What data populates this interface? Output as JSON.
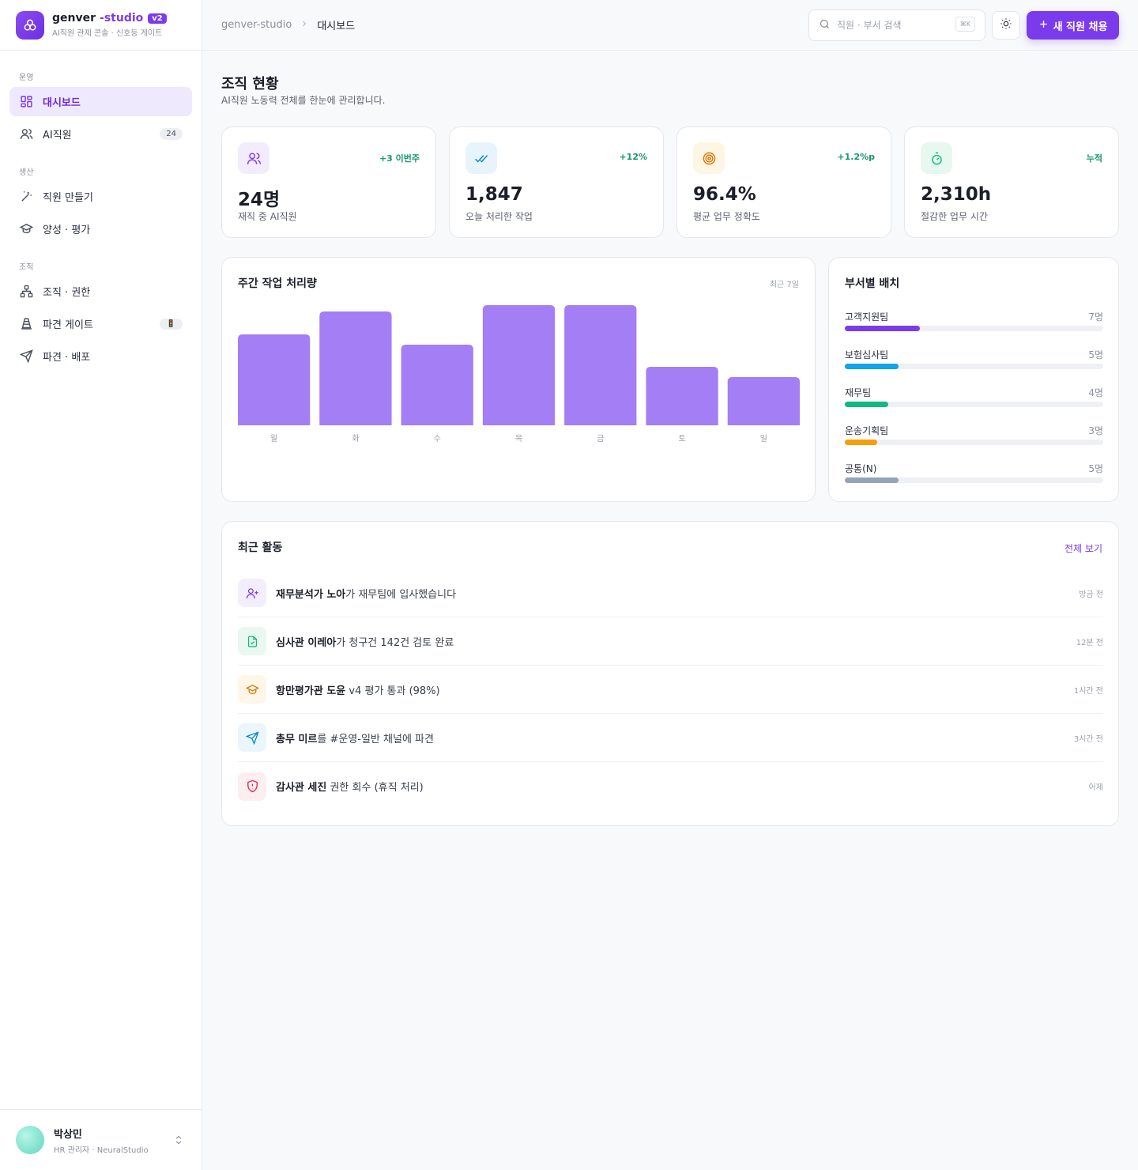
{
  "brand": {
    "name": "genver",
    "suffix": "-studio",
    "badge": "v2",
    "subtitle": "AI직원 관제 콘솔 · 신호등 게이트"
  },
  "nav": {
    "sections": [
      "운영",
      "생산",
      "조직"
    ],
    "items": [
      {
        "label": "대시보드",
        "icon": "dashboard-icon"
      },
      {
        "label": "AI직원",
        "icon": "users-icon",
        "count": "24"
      },
      {
        "label": "직원 만들기",
        "icon": "magic-wand-icon"
      },
      {
        "label": "양성 · 평가",
        "icon": "graduation-cap-icon"
      },
      {
        "label": "조직 · 권한",
        "icon": "org-chart-icon"
      },
      {
        "label": "파견 게이트",
        "icon": "cone-icon",
        "badge": "🚦"
      },
      {
        "label": "파견 · 배포",
        "icon": "send-icon"
      }
    ]
  },
  "user": {
    "name": "박상민",
    "role": "HR 관리자 · NeuralStudio"
  },
  "topbar": {
    "breadcrumb_root": "genver-studio",
    "breadcrumb_current": "대시보드",
    "search_placeholder": "직원 · 부서 검색",
    "search_shortcut": "⌘K",
    "hire_label": "새 직원 채용"
  },
  "page": {
    "title": "조직 현황",
    "subtitle": "AI직원 노동력 전체를 한눈에 관리합니다."
  },
  "stats": [
    {
      "value": "24명",
      "label": "재직 중 AI직원",
      "delta": "+3 이번주",
      "icon": "users-icon"
    },
    {
      "value": "1,847",
      "label": "오늘 처리한 작업",
      "delta": "+12%",
      "icon": "double-check-icon"
    },
    {
      "value": "96.4%",
      "label": "평균 업무 정확도",
      "delta": "+1.2%p",
      "icon": "target-icon"
    },
    {
      "value": "2,310h",
      "label": "절감한 업무 시간",
      "delta": "누적",
      "icon": "stopwatch-icon"
    }
  ],
  "weekly": {
    "title": "주간 작업 처리량",
    "meta": "최근 7일"
  },
  "chart_data": {
    "type": "bar",
    "categories": [
      "월",
      "화",
      "수",
      "목",
      "금",
      "토",
      "일"
    ],
    "values": [
      115,
      144,
      102,
      152,
      152,
      74,
      61
    ],
    "ylim": [
      0,
      152
    ],
    "color": "#a47ef4",
    "grid": false
  },
  "departments": {
    "title": "부서별 배치",
    "items": [
      {
        "name": "고객지원팀",
        "count": "7명",
        "value": 7,
        "color": "#7c3aed"
      },
      {
        "name": "보험심사팀",
        "count": "5명",
        "value": 5,
        "color": "#0ea5e9"
      },
      {
        "name": "재무팀",
        "count": "4명",
        "value": 4,
        "color": "#10b981"
      },
      {
        "name": "운송기획팀",
        "count": "3명",
        "value": 3,
        "color": "#f59e0b"
      },
      {
        "name": "공통(N)",
        "count": "5명",
        "value": 5,
        "color": "#94a3b8"
      }
    ],
    "max": 24
  },
  "activity": {
    "title": "최근 활동",
    "link": "전체 보기",
    "items": [
      {
        "actor": "재무분석가 노아",
        "text": "가 재무팀에 입사했습니다",
        "time": "방금 전",
        "icon": "user-plus-icon",
        "bg": "#f3eefe",
        "fg": "#7c3aed"
      },
      {
        "actor": "심사관 이레아",
        "text": "가 청구건 142건 검토 완료",
        "time": "12분 전",
        "icon": "file-check-icon",
        "bg": "#e9f8f1",
        "fg": "#10b981"
      },
      {
        "actor": "항만평가관 도윤",
        "text": " v4 평가 통과 (98%)",
        "time": "1시간 전",
        "icon": "graduation-cap-icon",
        "bg": "#fef6e6",
        "fg": "#d97706"
      },
      {
        "actor": "총무 미르",
        "text": "를 #운영-일반 채널에 파견",
        "time": "3시간 전",
        "icon": "send-icon",
        "bg": "#eaf5fc",
        "fg": "#0284c7"
      },
      {
        "actor": "감사관 세진",
        "text": " 권한 회수 (휴직 처리)",
        "time": "어제",
        "icon": "shield-alert-icon",
        "bg": "#fdeef0",
        "fg": "#e11d48"
      }
    ]
  }
}
